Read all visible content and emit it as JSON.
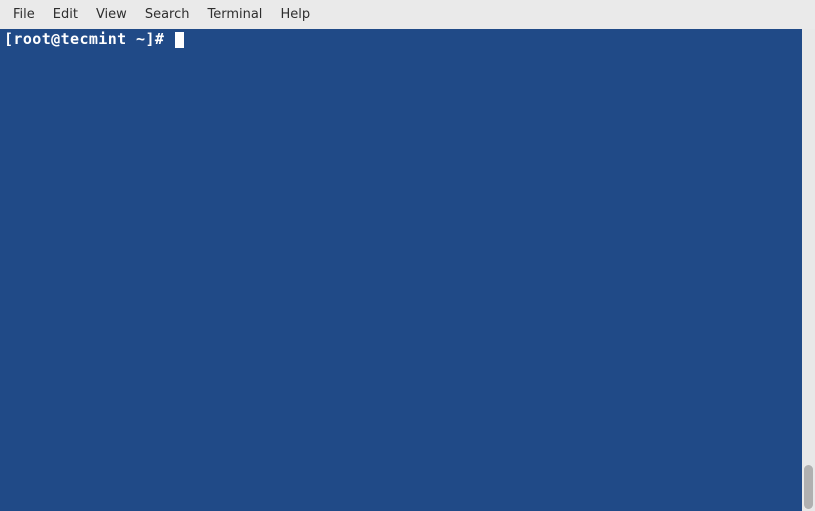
{
  "menubar": {
    "items": [
      {
        "label": "File"
      },
      {
        "label": "Edit"
      },
      {
        "label": "View"
      },
      {
        "label": "Search"
      },
      {
        "label": "Terminal"
      },
      {
        "label": "Help"
      }
    ]
  },
  "terminal": {
    "prompt": "[root@tecmint ~]# "
  }
}
